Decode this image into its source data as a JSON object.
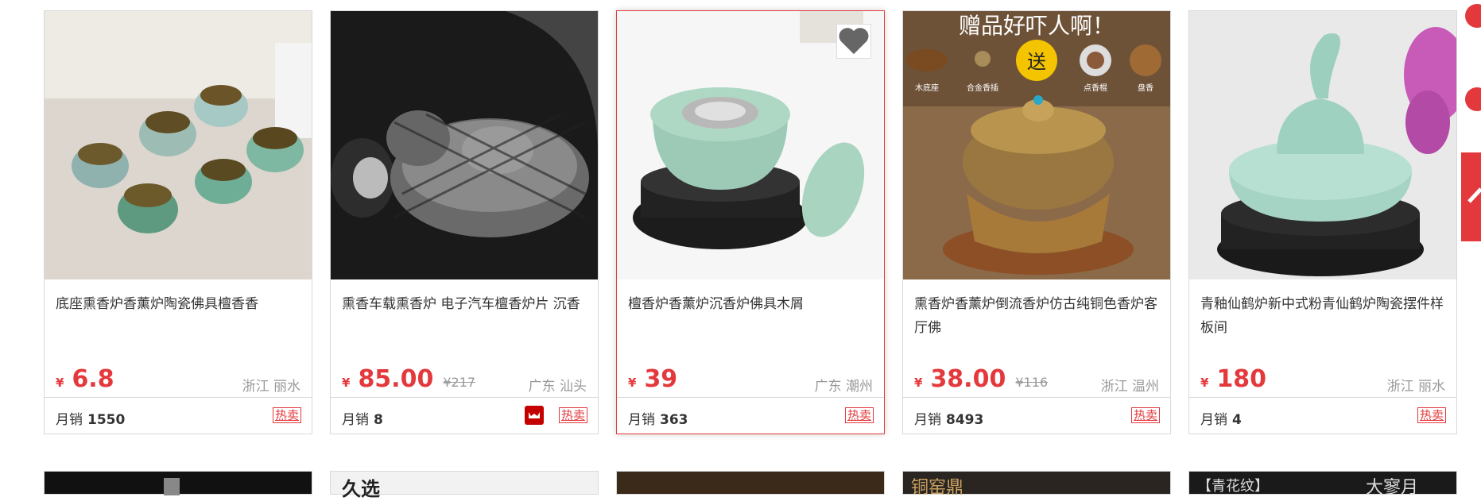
{
  "products": [
    {
      "title": "底座熏香炉香薰炉陶瓷佛具檀香香",
      "currency": "¥",
      "price": "6.8",
      "old_price": "",
      "location": "浙江 丽水",
      "sales_label": "月销",
      "sales": "1550",
      "hot": "热卖",
      "tmall": false
    },
    {
      "title": "熏香车载熏香炉 电子汽车檀香炉片 沉香",
      "currency": "¥",
      "price": "85.00",
      "old_price": "¥217",
      "location": "广东 汕头",
      "sales_label": "月销",
      "sales": "8",
      "hot": "热卖",
      "tmall": true
    },
    {
      "title": "檀香炉香薰炉沉香炉佛具木屑",
      "currency": "¥",
      "price": "39",
      "old_price": "",
      "location": "广东 潮州",
      "sales_label": "月销",
      "sales": "363",
      "hot": "热卖",
      "tmall": false,
      "hovered": true
    },
    {
      "title": "熏香炉香薰炉倒流香炉仿古纯铜色香炉客厅佛",
      "currency": "¥",
      "price": "38.00",
      "old_price": "¥116",
      "location": "浙江 温州",
      "sales_label": "月销",
      "sales": "8493",
      "hot": "热卖",
      "tmall": false
    },
    {
      "title": "青釉仙鹤炉新中式粉青仙鹤炉陶瓷摆件样板间",
      "currency": "¥",
      "price": "180",
      "old_price": "",
      "location": "浙江 丽水",
      "sales_label": "月销",
      "sales": "4",
      "hot": "热卖",
      "tmall": false
    }
  ],
  "promo_image_text": {
    "headline": "赠品好吓人啊！",
    "send": "送",
    "items": [
      "木底座",
      "合金香插",
      "点香棍",
      "盘香"
    ]
  },
  "row2_texts": [
    "久选",
    "铜窑鼎",
    "【青花纹】",
    "大寥月"
  ],
  "colors": {
    "accent": "#e4393c",
    "border": "#d9d9d9",
    "muted": "#999999"
  }
}
